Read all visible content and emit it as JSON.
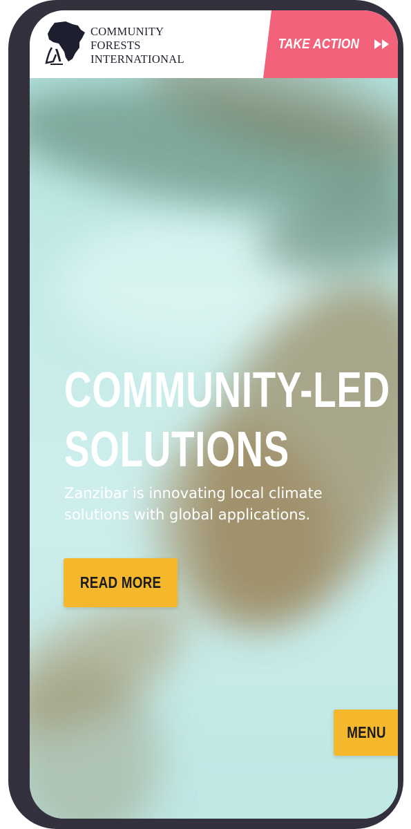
{
  "header": {
    "logo_lines": [
      "COMMUNITY",
      "FORESTS",
      "INTERNATIONAL"
    ],
    "take_action_label": "TAKE ACTION"
  },
  "hero": {
    "title_lines": [
      "COMMUNITY-LED",
      "SOLUTIONS"
    ],
    "subtitle": "Zanzibar is innovating local climate solutions with global applications.",
    "read_more_label": "READ MORE"
  },
  "menu_label": "MENU",
  "colors": {
    "take_action_bg": "#f2627a",
    "button_yellow": "#f5b82c",
    "phone_frame": "#34313f"
  },
  "icons": {
    "logo": "africa-continent-logo",
    "take_action": "fast-forward-icon"
  }
}
